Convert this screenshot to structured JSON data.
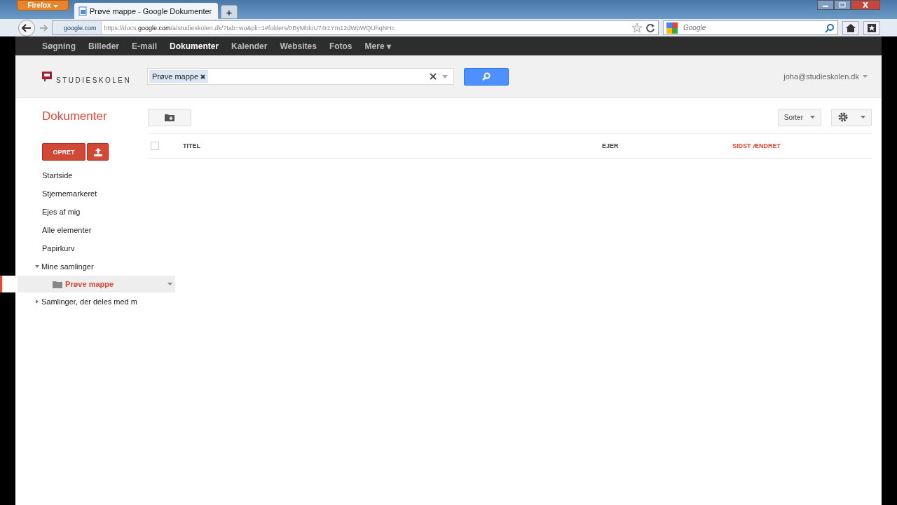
{
  "browser": {
    "menu_button": "Firefox",
    "tab_title": "Prøve mappe - Google Dokumenter",
    "new_tab": "+",
    "site_badge": "google.com",
    "url_prefix": "https://docs.",
    "url_domain": "google.com",
    "url_rest": "/a/studieskolen.dk/?tab=wo&pli=1#folders/0ByMbloU74r1Ym12dWpWQUhqNHc",
    "search_placeholder": "Google"
  },
  "nav": [
    {
      "label": "Søgning",
      "selected": false
    },
    {
      "label": "Billeder",
      "selected": false
    },
    {
      "label": "E-mail",
      "selected": false
    },
    {
      "label": "Dokumenter",
      "selected": true
    },
    {
      "label": "Kalender",
      "selected": false
    },
    {
      "label": "Websites",
      "selected": false
    },
    {
      "label": "Fotos",
      "selected": false
    },
    {
      "label": "Mere ▾",
      "selected": false
    }
  ],
  "logo": "STUDIESKOLEN",
  "search": {
    "chip": "Prøve mappe"
  },
  "account": "joha@studieskolen.dk",
  "page_title": "Dokumenter",
  "sort_button": "Sorter",
  "create_button": "OPRET",
  "columns": [
    {
      "label": "TITEL",
      "selected": false
    },
    {
      "label": "EJER",
      "selected": false
    },
    {
      "label": "SIDST ÆNDRET",
      "selected": true
    }
  ],
  "sidebar": [
    {
      "label": "Startside"
    },
    {
      "label": "Stjernemarkeret"
    },
    {
      "label": "Ejes af mig"
    },
    {
      "label": "Alle elementer"
    },
    {
      "label": "Papirkurv"
    }
  ],
  "tree": [
    {
      "label": "Mine samlinger",
      "expanded": true,
      "children": [
        {
          "label": "Prøve mappe",
          "selected": true
        }
      ]
    },
    {
      "label": "Samlinger, der deles med m",
      "expanded": false
    }
  ],
  "select_all": {
    "checked": false
  }
}
